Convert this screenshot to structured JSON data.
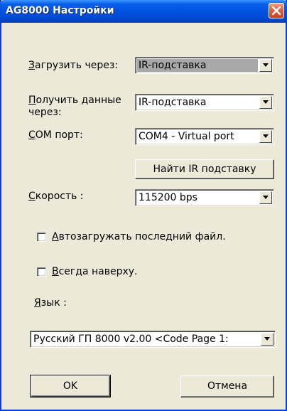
{
  "window": {
    "title": "AG8000 Настройки"
  },
  "fields": {
    "load_via": {
      "label_first": "З",
      "label_rest": "агрузить через:",
      "value": "IR-подставка"
    },
    "receive_via": {
      "label_first": "П",
      "label_line1_rest": "олучить данные",
      "label_line2": "через:",
      "value": "IR-подставка"
    },
    "com_port": {
      "label_first": "C",
      "label_rest": "OM порт:",
      "value": "COM4 - Virtual port"
    },
    "find_ir_button": "Найти IR подставку",
    "speed": {
      "label_first": "С",
      "label_rest": "корость :",
      "value": "115200 bps"
    },
    "autoload": {
      "label_first": "А",
      "label_rest": "втозагружать последний файл.",
      "checked": false
    },
    "always_on_top": {
      "label_first": "В",
      "label_rest": "сегда наверху.",
      "checked": false
    },
    "language": {
      "label_first": "Я",
      "label_rest": "зык :",
      "value": "Русский ГП 8000 v2.00 <Code Page 1:"
    }
  },
  "buttons": {
    "ok": "OK",
    "cancel": "Отмена"
  }
}
